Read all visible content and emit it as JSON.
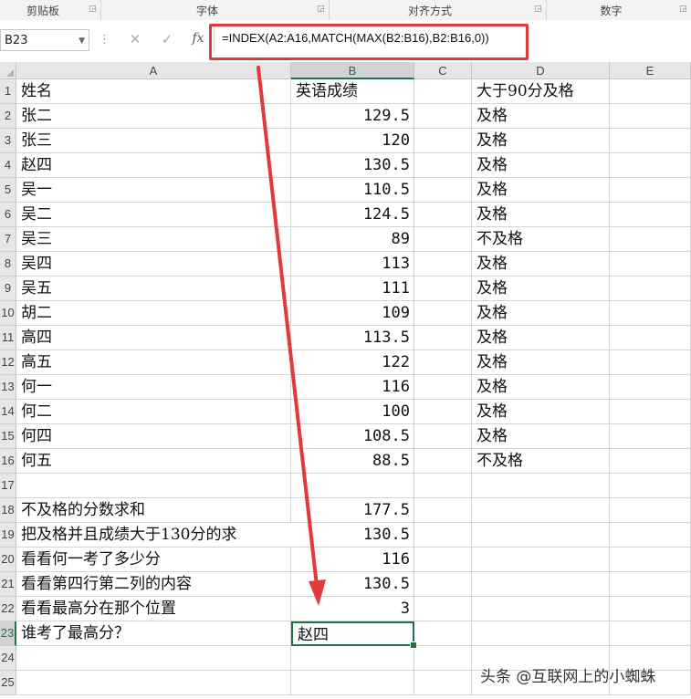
{
  "ribbon": {
    "groups": [
      "剪贴板",
      "字体",
      "对齐方式",
      "数字"
    ]
  },
  "formula_bar": {
    "name_box": "B23",
    "fx_label": "fx",
    "formula": "=INDEX(A2:A16,MATCH(MAX(B2:B16),B2:B16,0))"
  },
  "columns": [
    "A",
    "B",
    "C",
    "D",
    "E"
  ],
  "rows": [
    {
      "n": "1",
      "a": "姓名",
      "b": "英语成绩",
      "d": "大于90分及格"
    },
    {
      "n": "2",
      "a": "张二",
      "b": "129.5",
      "d": "及格"
    },
    {
      "n": "3",
      "a": "张三",
      "b": "120",
      "d": "及格"
    },
    {
      "n": "4",
      "a": "赵四",
      "b": "130.5",
      "d": "及格"
    },
    {
      "n": "5",
      "a": "吴一",
      "b": "110.5",
      "d": "及格"
    },
    {
      "n": "6",
      "a": "吴二",
      "b": "124.5",
      "d": "及格"
    },
    {
      "n": "7",
      "a": "吴三",
      "b": "89",
      "d": "不及格"
    },
    {
      "n": "8",
      "a": "吴四",
      "b": "113",
      "d": "及格"
    },
    {
      "n": "9",
      "a": "吴五",
      "b": "111",
      "d": "及格"
    },
    {
      "n": "10",
      "a": "胡二",
      "b": "109",
      "d": "及格"
    },
    {
      "n": "11",
      "a": "高四",
      "b": "113.5",
      "d": "及格"
    },
    {
      "n": "12",
      "a": "高五",
      "b": "122",
      "d": "及格"
    },
    {
      "n": "13",
      "a": "何一",
      "b": "116",
      "d": "及格"
    },
    {
      "n": "14",
      "a": "何二",
      "b": "100",
      "d": "及格"
    },
    {
      "n": "15",
      "a": "何四",
      "b": "108.5",
      "d": "及格"
    },
    {
      "n": "16",
      "a": "何五",
      "b": "88.5",
      "d": "不及格"
    },
    {
      "n": "17",
      "a": "",
      "b": "",
      "d": ""
    },
    {
      "n": "18",
      "a": "不及格的分数求和",
      "b": "177.5",
      "d": ""
    },
    {
      "n": "19",
      "a": "把及格并且成绩大于130分的求",
      "b": "130.5",
      "d": ""
    },
    {
      "n": "20",
      "a": "看看何一考了多少分",
      "b": "116",
      "d": ""
    },
    {
      "n": "21",
      "a": "看看第四行第二列的内容",
      "b": "130.5",
      "d": ""
    },
    {
      "n": "22",
      "a": "看看最高分在那个位置",
      "b": "3",
      "d": ""
    },
    {
      "n": "23",
      "a": "谁考了最高分？",
      "b": "赵四",
      "d": ""
    },
    {
      "n": "24",
      "a": "",
      "b": "",
      "d": ""
    },
    {
      "n": "25",
      "a": "",
      "b": "",
      "d": ""
    }
  ],
  "active_cell": "B23",
  "annotation_color": "#e23a3a",
  "watermark": "头条 @互联网上的小蜘蛛"
}
